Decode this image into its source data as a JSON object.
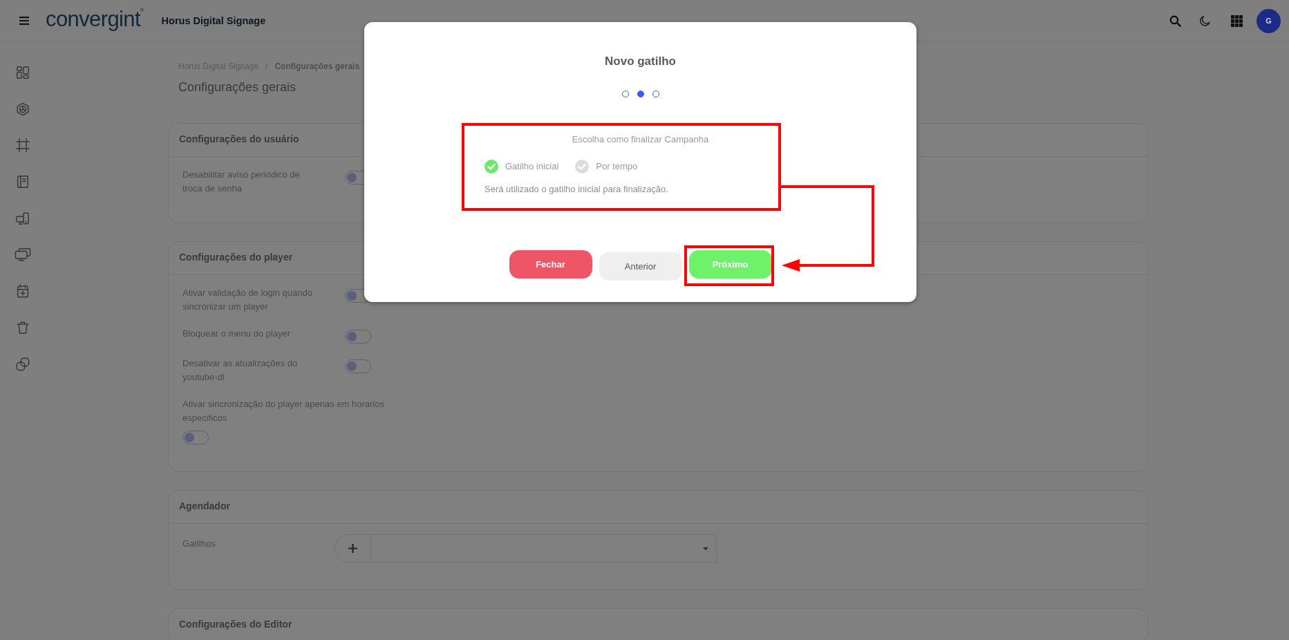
{
  "header": {
    "brand": "convergint$^{®}$",
    "app_title": "Horus Digital Signage",
    "avatar_initial": "G"
  },
  "breadcrumb": {
    "items": [
      {
        "label": "Horus Digital Signage",
        "current": false
      },
      {
        "label": "Configurações gerais",
        "current": true
      }
    ],
    "separator": "/"
  },
  "page_title": "Configurações gerais",
  "sections": [
    {
      "title": "Configurações do usuário",
      "settings": [
        {
          "kind": "toggle",
          "label": "Desabilitar aviso periódico de troca de senha",
          "on": false
        }
      ]
    },
    {
      "title": "Configurações do player",
      "settings": [
        {
          "kind": "toggle",
          "label": "Ativar validação de login quando sincronizar um player",
          "on": false
        },
        {
          "kind": "toggle",
          "label": "Bloquear o menu do player",
          "on": false
        },
        {
          "kind": "toggle",
          "label": "Desativar as atualizações do youtube-dl",
          "on": false
        },
        {
          "kind": "toggle_below",
          "label": "Ativar sincronização do player apenas em horarios especificos",
          "on": false
        }
      ]
    },
    {
      "title": "Agendador",
      "settings": [
        {
          "kind": "select",
          "label": "Gatilhos"
        }
      ]
    },
    {
      "title": "Configurações do Editor"
    }
  ],
  "modal": {
    "title": "Novo gatilho",
    "steps": [
      {
        "selected": false
      },
      {
        "selected": true
      },
      {
        "selected": false
      }
    ],
    "prompt": "Escolha como finalizar Campanha",
    "options": [
      {
        "label": "Gatilho inicial",
        "selected": true
      },
      {
        "label": "Por tempo",
        "selected": false
      }
    ],
    "note": "Será utilizado o gatilho inicial para finalização.",
    "buttons": [
      {
        "label": "Fechar",
        "kind": "danger"
      },
      {
        "label": "Anterior",
        "kind": "secondary"
      },
      {
        "label": "Próximo",
        "kind": "primary"
      }
    ]
  }
}
